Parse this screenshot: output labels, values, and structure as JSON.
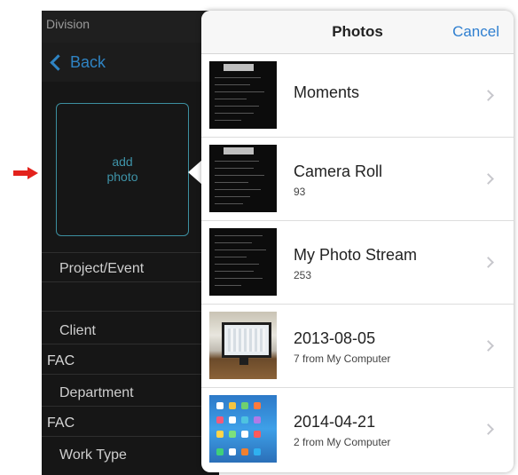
{
  "app": {
    "division_label": "Division",
    "back_label": "Back",
    "add_photo_label": "add photo",
    "fields": [
      {
        "label": "Project/Event",
        "value": ""
      },
      {
        "label": "Client",
        "value": "FAC"
      },
      {
        "label": "Department",
        "value": "FAC"
      },
      {
        "label": "Work Type",
        "value": ""
      }
    ]
  },
  "popover": {
    "title": "Photos",
    "cancel_label": "Cancel",
    "albums": [
      {
        "name": "Moments",
        "count": ""
      },
      {
        "name": "Camera Roll",
        "count": "93"
      },
      {
        "name": "My Photo Stream",
        "count": "253"
      },
      {
        "name": "2013-08-05",
        "count": "7 from My Computer"
      },
      {
        "name": "2014-04-21",
        "count": "2 from My Computer"
      }
    ]
  },
  "colors": {
    "accent": "#2f7fd0",
    "panel_bg": "#161616",
    "arrow": "#e3221c"
  }
}
